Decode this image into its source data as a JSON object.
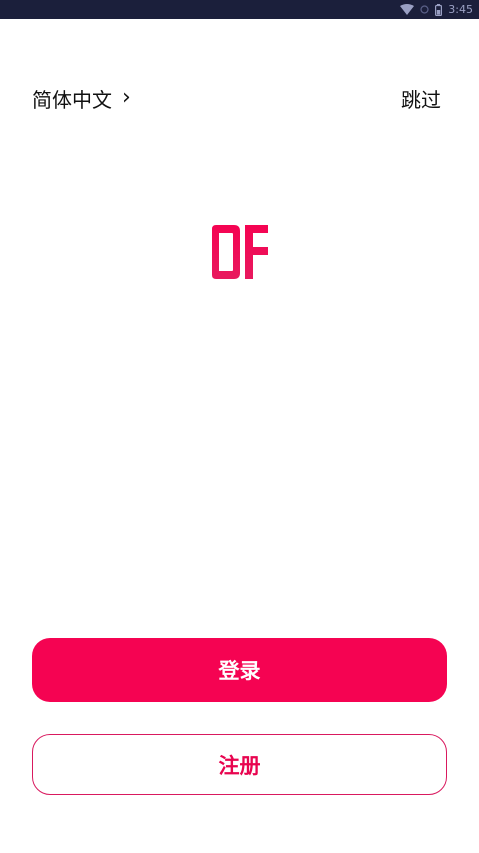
{
  "status_bar": {
    "time": "3:45",
    "icons": [
      "wifi-icon",
      "signal-icon",
      "battery-icon"
    ]
  },
  "header": {
    "language_label": "简体中文",
    "language_chevron": "›",
    "skip_label": "跳过"
  },
  "logo": {
    "name": "app-logo",
    "color_top": "#f50352",
    "color_bottom": "#e8195e"
  },
  "actions": {
    "login_label": "登录",
    "register_label": "注册"
  },
  "colors": {
    "accent": "#f50352",
    "status_bar_bg": "#1b1f3b"
  }
}
